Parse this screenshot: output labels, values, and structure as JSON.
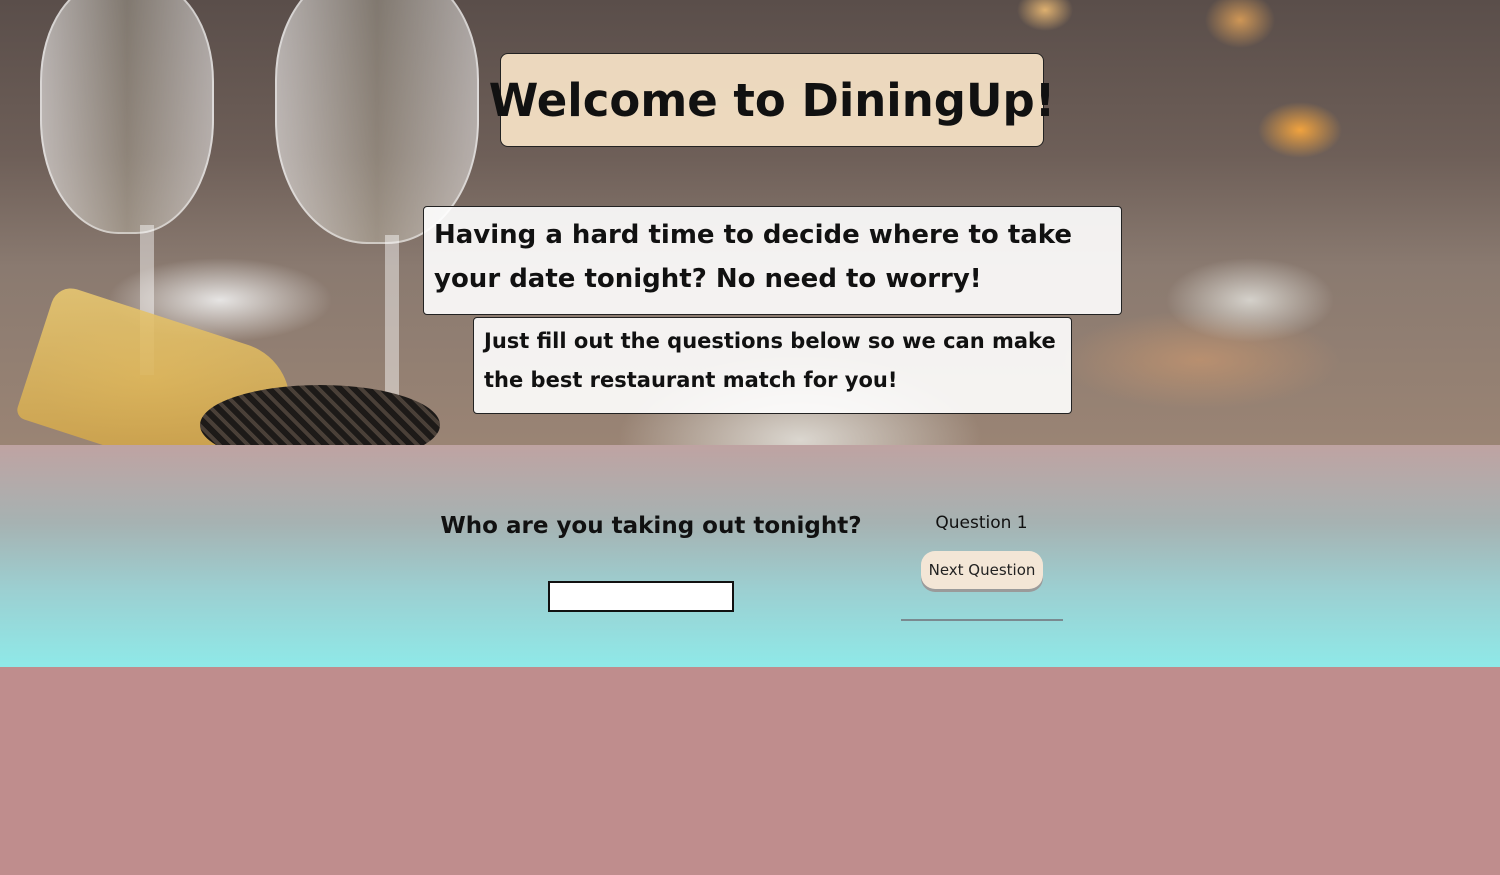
{
  "hero": {
    "title": "Welcome to DiningUp!",
    "intro": "Having a hard time to decide where to take your date tonight? No need to worry!",
    "subtitle": "Just fill out the questions below so we can make the best restaurant match for you!"
  },
  "question": {
    "text": "Who are you taking out tonight?",
    "answer_value": "",
    "counter_label": "Question 1",
    "next_button_label": "Next Question"
  },
  "colors": {
    "page_background": "#bf8d8d",
    "band_top": "#bfa3a2",
    "band_bottom": "#8fe9e8",
    "title_box": "#ffebcd",
    "button": "#f3e6d6"
  }
}
